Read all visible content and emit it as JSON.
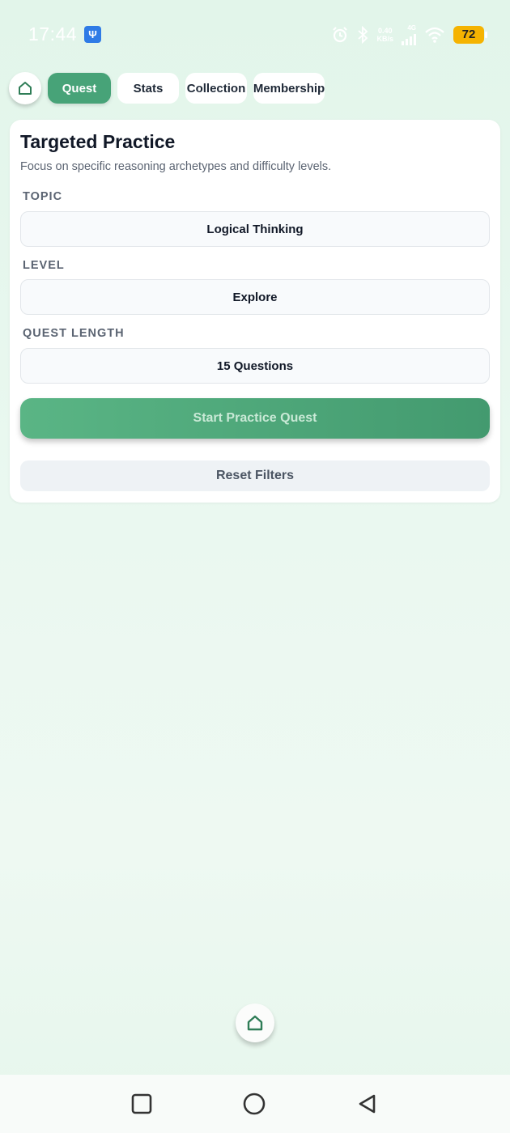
{
  "status_bar": {
    "time": "17:44",
    "usb_icon": "usb-icon",
    "net_speed_value": "0.40",
    "net_speed_unit": "KB/s",
    "signal_label": "4G",
    "battery": "72"
  },
  "tabs": {
    "home_icon": "home-icon",
    "items": [
      {
        "label": "Quest",
        "active": true
      },
      {
        "label": "Stats",
        "active": false
      },
      {
        "label": "Collection",
        "active": false
      },
      {
        "label": "Membership",
        "active": false
      }
    ]
  },
  "practice": {
    "title": "Targeted Practice",
    "subtitle": "Focus on specific reasoning archetypes and difficulty levels.",
    "topic_label": "TOPIC",
    "topic_value": "Logical Thinking",
    "level_label": "LEVEL",
    "level_value": "Explore",
    "length_label": "QUEST LENGTH",
    "length_value": "15 Questions",
    "start_button": "Start Practice Quest",
    "reset_button": "Reset Filters"
  },
  "colors": {
    "accent": "#47a378",
    "background": "#e6f6ec",
    "battery": "#f5b301"
  }
}
